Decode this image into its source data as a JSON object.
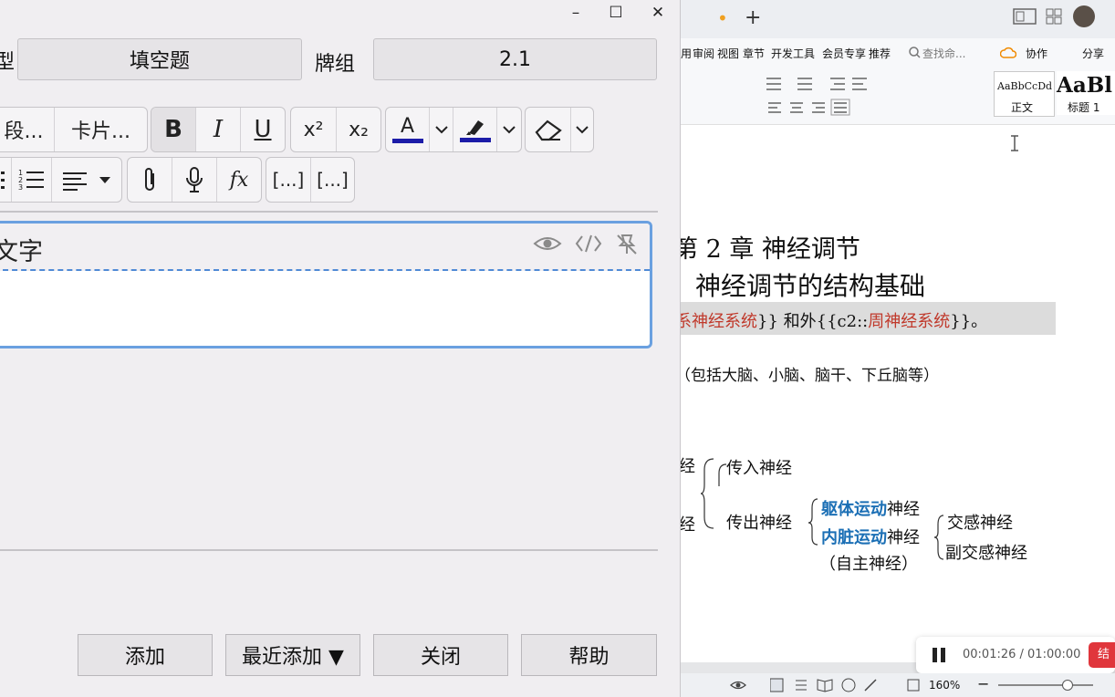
{
  "anki": {
    "window_controls": {
      "minimize": "–",
      "maximize": "☐",
      "close": "✕"
    },
    "note_type_partial": "型",
    "note_type_value": "填空题",
    "deck_label": "牌组",
    "deck_value": "2.1",
    "toolbar": {
      "fields_btn": "段...",
      "cards_btn": "卡片...",
      "bold": "B",
      "italic": "I",
      "underline": "U",
      "superscript": "x²",
      "subscript": "x₂",
      "text_color": "A",
      "fx": "𝑓x",
      "cloze": "[...]",
      "cloze_same": "[...]"
    },
    "field": {
      "label": "文字"
    },
    "buttons": {
      "add": "添加",
      "history": "最近添加 ▼",
      "close": "关闭",
      "help": "帮助"
    }
  },
  "wps": {
    "tab_dot": "•",
    "new_tab": "+",
    "menu_items": [
      "用",
      "审阅",
      "视图",
      "章节",
      "开发工具",
      "会员专享",
      "推荐"
    ],
    "search_placeholder": "查找命...",
    "collab": "协作",
    "share": "分享",
    "styles": {
      "normal_preview": "AaBbCcDd",
      "normal_name": "正文",
      "h1_preview": "AaBl",
      "h1_name": "标题 1"
    },
    "doc": {
      "chapter": "第 2 章  神经调节",
      "section": "神经调节的结构基础",
      "line1_a": "系神经系统",
      "line1_b": "}}  和外{{c2::",
      "line1_c": "周神经系统",
      "line1_d": "}}。",
      "line2": "（包括大脑、小脑、脑干、下丘脑等）",
      "jing1": "经",
      "jing2": "经",
      "afferent": "传入神经",
      "efferent": "传出神经",
      "somatic_a": "躯体运动",
      "somatic_b": "神经",
      "visceral_a": "内脏运动",
      "visceral_b": "神经",
      "autonomic": "（自主神经）",
      "sympathetic": "交感神经",
      "parasympathetic": "副交感神经"
    },
    "recorder": {
      "time": "00:01:26 / 01:00:00",
      "end_btn": "结"
    },
    "status": {
      "zoom": "160%"
    }
  }
}
